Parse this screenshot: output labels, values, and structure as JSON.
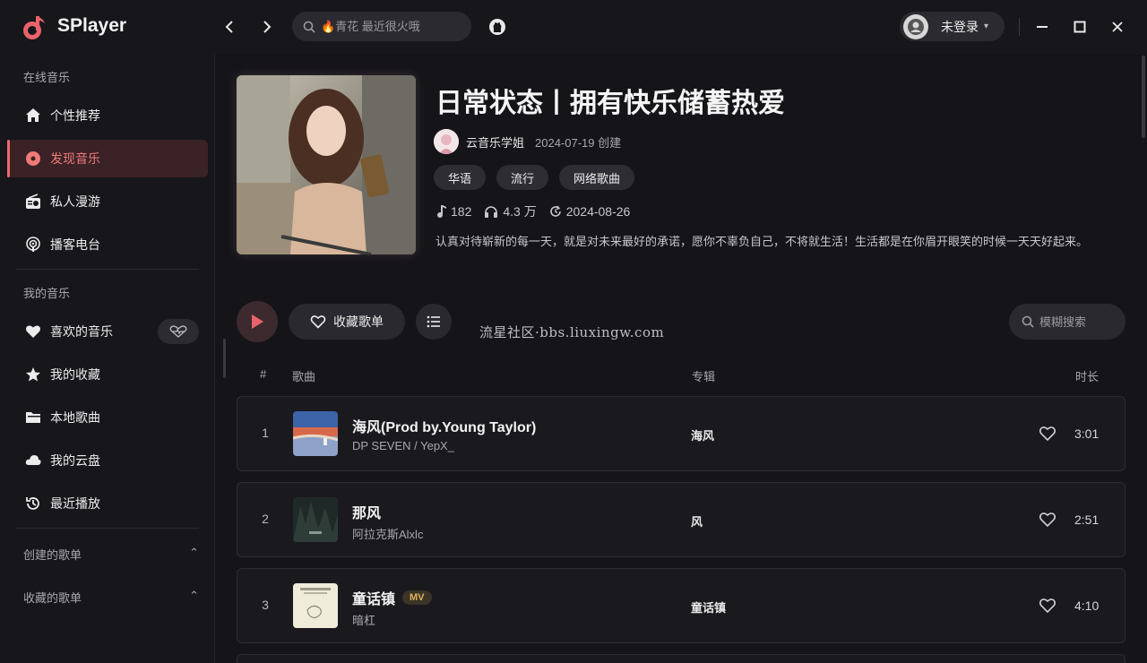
{
  "app": {
    "name": "SPlayer"
  },
  "search": {
    "placeholder": "🔥青花 最近很火哦"
  },
  "user": {
    "name": "未登录"
  },
  "sidebar": {
    "online_title": "在线音乐",
    "online_items": [
      {
        "label": "个性推荐",
        "icon": "home-icon"
      },
      {
        "label": "发现音乐",
        "icon": "disc-icon",
        "active": true
      },
      {
        "label": "私人漫游",
        "icon": "radio-icon"
      },
      {
        "label": "播客电台",
        "icon": "podcast-icon"
      }
    ],
    "my_title": "我的音乐",
    "my_items": [
      {
        "label": "喜欢的音乐",
        "icon": "heart-icon"
      },
      {
        "label": "我的收藏",
        "icon": "star-icon"
      },
      {
        "label": "本地歌曲",
        "icon": "folder-icon"
      },
      {
        "label": "我的云盘",
        "icon": "cloud-icon"
      },
      {
        "label": "最近播放",
        "icon": "history-icon"
      }
    ],
    "created_playlists": "创建的歌单",
    "collected_playlists": "收藏的歌单"
  },
  "playlist": {
    "title": "日常状态丨拥有快乐储蓄热爱",
    "creator": "云音乐学姐",
    "created": "2024-07-19 创建",
    "tags": [
      "华语",
      "流行",
      "网络歌曲"
    ],
    "track_count": "182",
    "play_count": "4.3 万",
    "updated": "2024-08-26",
    "description": "认真对待崭新的每一天，就是对未来最好的承诺，愿你不辜负自己，不将就生活！生活都是在你眉开眼笑的时候一天天好起来。"
  },
  "actions": {
    "collect_label": "收藏歌单",
    "fuzzy_placeholder": "模糊搜索"
  },
  "watermark": "流星社区·bbs.liuxingw.com",
  "table": {
    "headers": {
      "index": "#",
      "song": "歌曲",
      "album": "专辑",
      "duration": "时长"
    },
    "rows": [
      {
        "index": "1",
        "name": "海风(Prod by.Young Taylor)",
        "artist": "DP SEVEN / YepX_",
        "album": "海风",
        "duration": "3:01",
        "mv": false
      },
      {
        "index": "2",
        "name": "那风",
        "artist": "阿拉克斯Alxlc",
        "album": "风",
        "duration": "2:51",
        "mv": false
      },
      {
        "index": "3",
        "name": "童话镇",
        "artist": "暗杠",
        "album": "童话镇",
        "duration": "4:10",
        "mv": true,
        "mv_label": "MV"
      }
    ]
  },
  "colors": {
    "accent": "#e86b6b",
    "background": "#151419",
    "sidebar": "#17161b"
  }
}
